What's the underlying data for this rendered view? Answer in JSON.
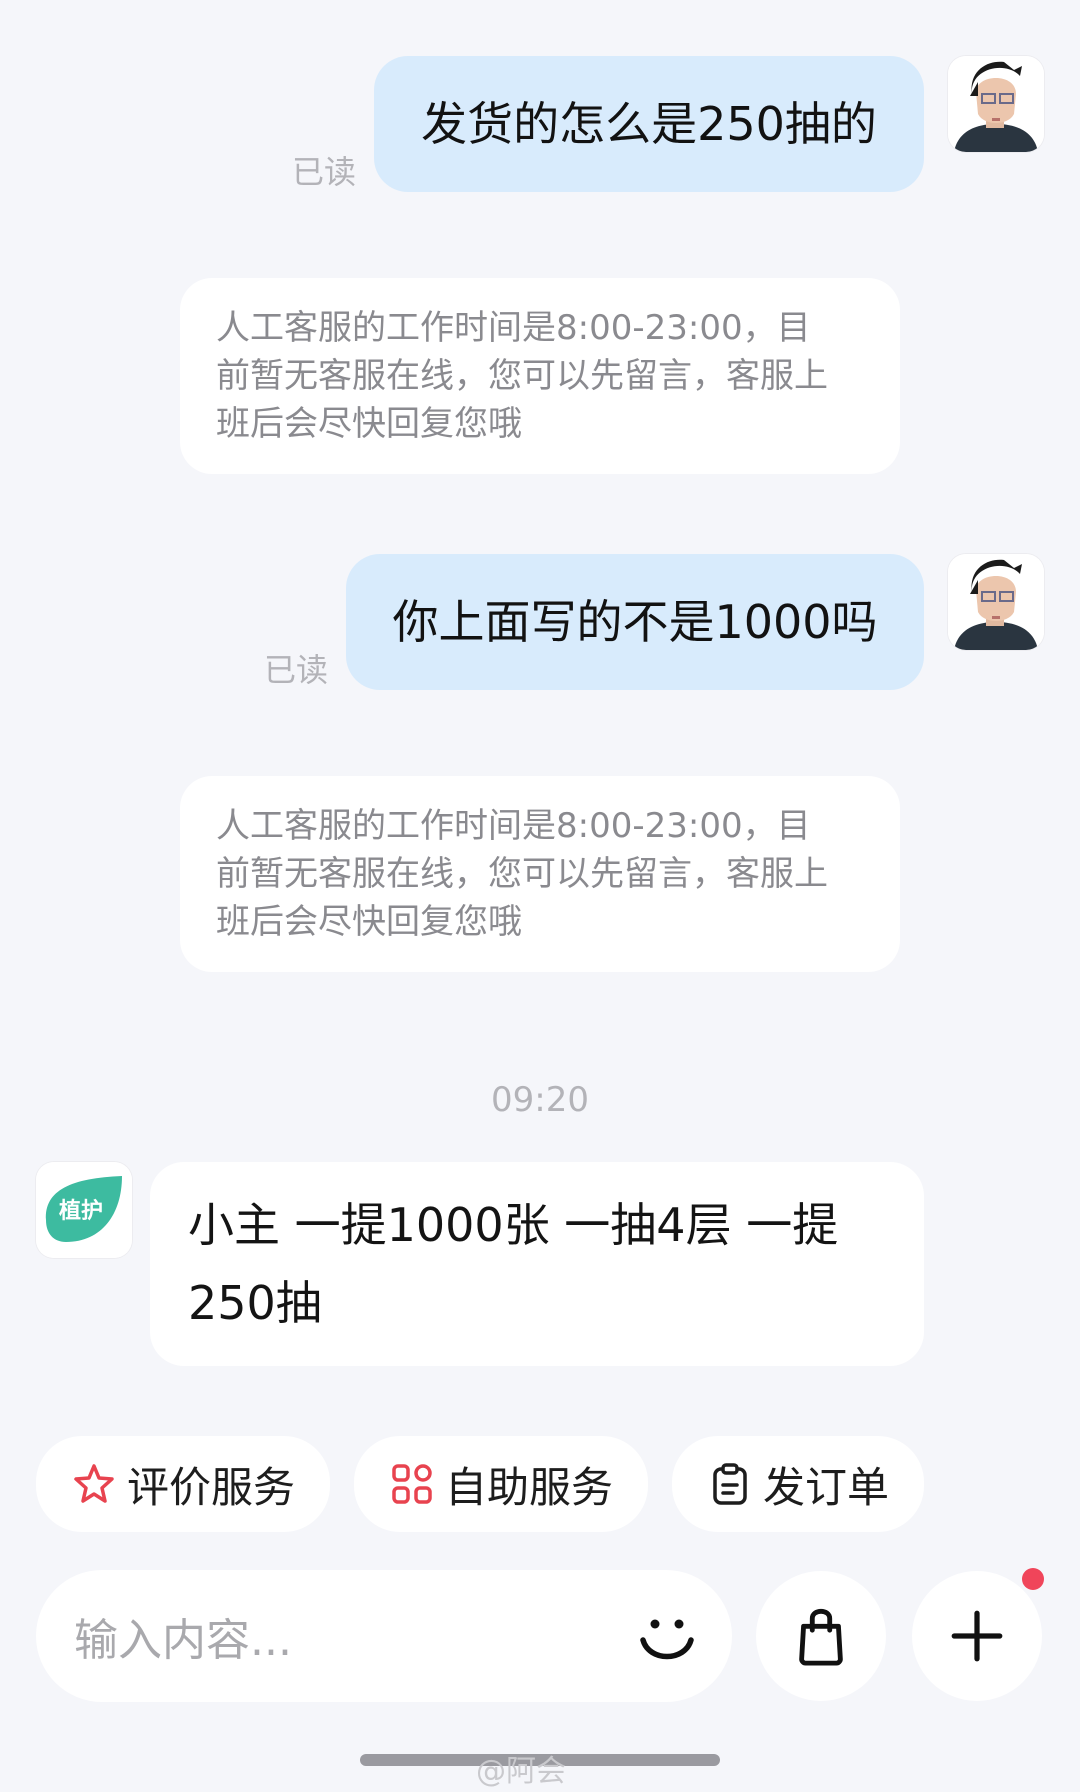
{
  "messages": [
    {
      "type": "outgoing",
      "text": "发货的怎么是250抽的",
      "status": "已读"
    },
    {
      "type": "system",
      "lines": [
        "人工客服的工作时间是8:00-23:00，目",
        "前暂无客服在线，您可以先留言，客服上",
        "班后会尽快回复您哦"
      ]
    },
    {
      "type": "outgoing",
      "text": "你上面写的不是1000吗",
      "status": "已读"
    },
    {
      "type": "system",
      "lines": [
        "人工客服的工作时间是8:00-23:00，目",
        "前暂无客服在线，您可以先留言，客服上",
        "班后会尽快回复您哦"
      ]
    },
    {
      "type": "timestamp",
      "text": "09:20"
    },
    {
      "type": "incoming",
      "lines": [
        "小主 一提1000张 一抽4层 一提",
        "250抽"
      ],
      "avatar_logo_text": "植护",
      "avatar_icon": "brand-logo-icon"
    }
  ],
  "quick_actions": [
    {
      "label": "评价服务",
      "icon": "star-icon",
      "color": "#e8434f"
    },
    {
      "label": "自助服务",
      "icon": "grid-icon",
      "color": "#e8434f"
    },
    {
      "label": "发订单",
      "icon": "clipboard-icon",
      "color": "#1d1d1d"
    }
  ],
  "composer": {
    "placeholder": "输入内容...",
    "emoji_icon": "smiley-icon",
    "bag_icon": "shopping-bag-icon",
    "plus_icon": "plus-icon",
    "notification_dot_color": "#f0455a"
  },
  "brand_color": "#3dbba0",
  "bubble_color": "#d8ebfc",
  "watermark": "@阿会"
}
